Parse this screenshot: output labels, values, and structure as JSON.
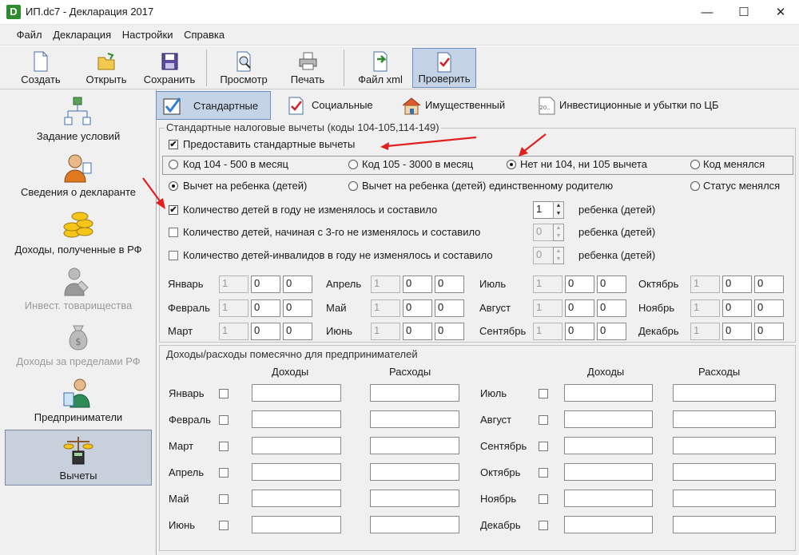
{
  "window": {
    "title": "ИП.dc7 - Декларация 2017",
    "icon_letter": "D",
    "min": "—",
    "max": "☐",
    "close": "✕"
  },
  "menu": [
    "Файл",
    "Декларация",
    "Настройки",
    "Справка"
  ],
  "toolbar": {
    "create": "Создать",
    "open": "Открыть",
    "save": "Сохранить",
    "preview": "Просмотр",
    "print": "Печать",
    "xml": "Файл xml",
    "check": "Проверить"
  },
  "sidebar": {
    "conditions": "Задание условий",
    "declarant": "Сведения о декларанте",
    "income_rf": "Доходы, полученные в РФ",
    "invest": "Инвест. товарищества",
    "income_abroad": "Доходы за пределами РФ",
    "entrepreneurs": "Предприниматели",
    "deductions": "Вычеты"
  },
  "tabs": {
    "standard": "Стандартные",
    "social": "Социальные",
    "property": "Имущественный",
    "invest": "Инвестиционные и убытки по ЦБ"
  },
  "standard": {
    "legend": "Стандартные налоговые вычеты (коды 104-105,114-149)",
    "provide_label": "Предоставить стандартные вычеты",
    "provide_checked": "✔",
    "code104": "Код 104 - 500 в месяц",
    "code105": "Код 105 - 3000 в месяц",
    "no104105": "Нет ни 104, ни 105 вычета",
    "code_changed": "Код менялся",
    "child": "Вычет на ребенка (детей)",
    "child_single": "Вычет на ребенка (детей) единственному родителю",
    "status_changed": "Статус менялся",
    "kids_unchanged_label": "Количество детей в году не изменялось и составило",
    "kids_unchanged_checked": "✔",
    "kids_unchanged_value": "1",
    "kids_third_label": "Количество детей, начиная с 3-го не изменялось и составило",
    "kids_third_value": "0",
    "kids_disabled_label": "Количество детей-инвалидов в году не изменялось и составило",
    "kids_disabled_value": "0",
    "kids_unit": "ребенка (детей)",
    "spin_up": "▲",
    "spin_down": "▼",
    "months": [
      {
        "name": "Январь",
        "v": [
          "1",
          "0",
          "0"
        ]
      },
      {
        "name": "Февраль",
        "v": [
          "1",
          "0",
          "0"
        ]
      },
      {
        "name": "Март",
        "v": [
          "1",
          "0",
          "0"
        ]
      },
      {
        "name": "Апрель",
        "v": [
          "1",
          "0",
          "0"
        ]
      },
      {
        "name": "Май",
        "v": [
          "1",
          "0",
          "0"
        ]
      },
      {
        "name": "Июнь",
        "v": [
          "1",
          "0",
          "0"
        ]
      },
      {
        "name": "Июль",
        "v": [
          "1",
          "0",
          "0"
        ]
      },
      {
        "name": "Август",
        "v": [
          "1",
          "0",
          "0"
        ]
      },
      {
        "name": "Сентябрь",
        "v": [
          "1",
          "0",
          "0"
        ]
      },
      {
        "name": "Октябрь",
        "v": [
          "1",
          "0",
          "0"
        ]
      },
      {
        "name": "Ноябрь",
        "v": [
          "1",
          "0",
          "0"
        ]
      },
      {
        "name": "Декабрь",
        "v": [
          "1",
          "0",
          "0"
        ]
      }
    ]
  },
  "monthly": {
    "legend": "Доходы/расходы помесячно для предпринимателей",
    "income": "Доходы",
    "expense": "Расходы",
    "months": [
      "Январь",
      "Февраль",
      "Март",
      "Апрель",
      "Май",
      "Июнь",
      "Июль",
      "Август",
      "Сентябрь",
      "Октябрь",
      "Ноябрь",
      "Декабрь"
    ]
  },
  "colors": {
    "accent": "#c5d3e6",
    "arrow": "#e02020",
    "window_bg": "#f0f0f0"
  }
}
